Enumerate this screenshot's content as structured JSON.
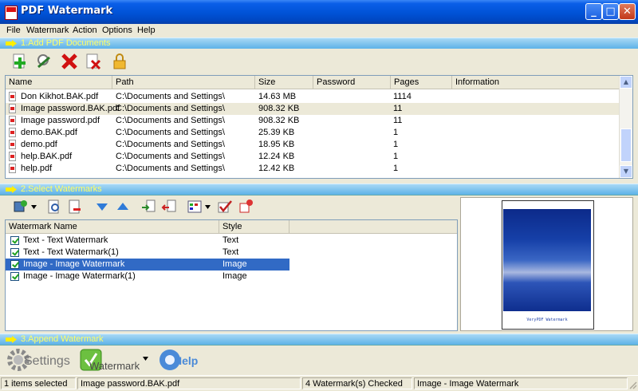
{
  "window": {
    "title": "PDF Watermark",
    "min_label": "_",
    "max_label": "□",
    "close_label": "✕"
  },
  "menu": [
    "File",
    "Watermark",
    "Action",
    "Options",
    "Help"
  ],
  "section1": {
    "label": "1.Add PDF Documents"
  },
  "section2": {
    "label": "2.Select Watermarks"
  },
  "section3": {
    "label": "3.Append Watermark"
  },
  "documents": {
    "columns": [
      "Name",
      "Path",
      "Size",
      "Password",
      "Pages",
      "Information"
    ],
    "rows": [
      {
        "name": "Don Kikhot.BAK.pdf",
        "path": "C:\\Documents and Settings\\",
        "size": "14.63 MB",
        "password": "",
        "pages": "1114",
        "info": ""
      },
      {
        "name": "Image password.BAK.pdf",
        "path": "C:\\Documents and Settings\\",
        "size": "908.32 KB",
        "password": "",
        "pages": "11",
        "info": ""
      },
      {
        "name": "Image password.pdf",
        "path": "C:\\Documents and Settings\\",
        "size": "908.32 KB",
        "password": "",
        "pages": "11",
        "info": ""
      },
      {
        "name": "demo.BAK.pdf",
        "path": "C:\\Documents and Settings\\",
        "size": "25.39 KB",
        "password": "",
        "pages": "1",
        "info": ""
      },
      {
        "name": "demo.pdf",
        "path": "C:\\Documents and Settings\\",
        "size": "18.95 KB",
        "password": "",
        "pages": "1",
        "info": ""
      },
      {
        "name": "help.BAK.pdf",
        "path": "C:\\Documents and Settings\\",
        "size": "12.24 KB",
        "password": "",
        "pages": "1",
        "info": ""
      },
      {
        "name": "help.pdf",
        "path": "C:\\Documents and Settings\\",
        "size": "12.42 KB",
        "password": "",
        "pages": "1",
        "info": ""
      }
    ],
    "selected_row": 1
  },
  "watermarks": {
    "columns": [
      "Watermark Name",
      "Style"
    ],
    "rows": [
      {
        "name": "Text - Text Watermark",
        "style": "Text",
        "checked": true
      },
      {
        "name": "Text - Text Watermark(1)",
        "style": "Text",
        "checked": true
      },
      {
        "name": "Image - Image Watermark",
        "style": "Image",
        "checked": true
      },
      {
        "name": "Image - Image Watermark(1)",
        "style": "Image",
        "checked": true
      }
    ],
    "selected_row": 2
  },
  "preview": {
    "caption": "VeryPDF Watermark"
  },
  "actions": {
    "settings_label": "Settings",
    "watermark_label": "Watermark",
    "help_label": "Help"
  },
  "status": {
    "selected_count": "1 items selected",
    "current_file": "Image password.BAK.pdf",
    "empty": "",
    "checked_count": "4 Watermark(s) Checked",
    "current_watermark": "Image - Image Watermark"
  },
  "colors": {
    "selection": "#316ac5",
    "row_highlight": "#ece9d8",
    "section_text": "#ffff66"
  }
}
